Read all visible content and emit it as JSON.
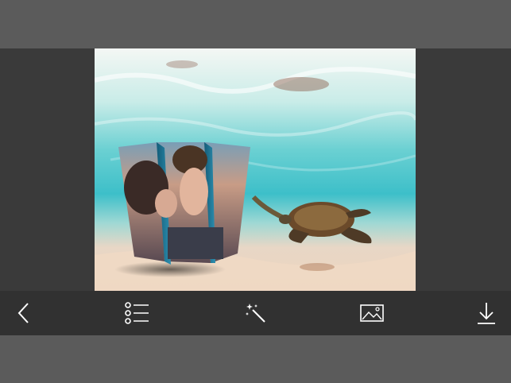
{
  "toolbar": {
    "items": [
      {
        "icon": "back-chevron-icon"
      },
      {
        "icon": "list-icon"
      },
      {
        "icon": "magic-wand-icon"
      },
      {
        "icon": "image-icon"
      },
      {
        "icon": "download-icon"
      }
    ]
  },
  "colors": {
    "top_bar": "#5b5b5b",
    "canvas_bg": "#3a3a3a",
    "toolbar_bg": "#313131",
    "icon_color": "#ffffff",
    "water": "#3fc0c8",
    "sand": "#e9d4c0"
  }
}
